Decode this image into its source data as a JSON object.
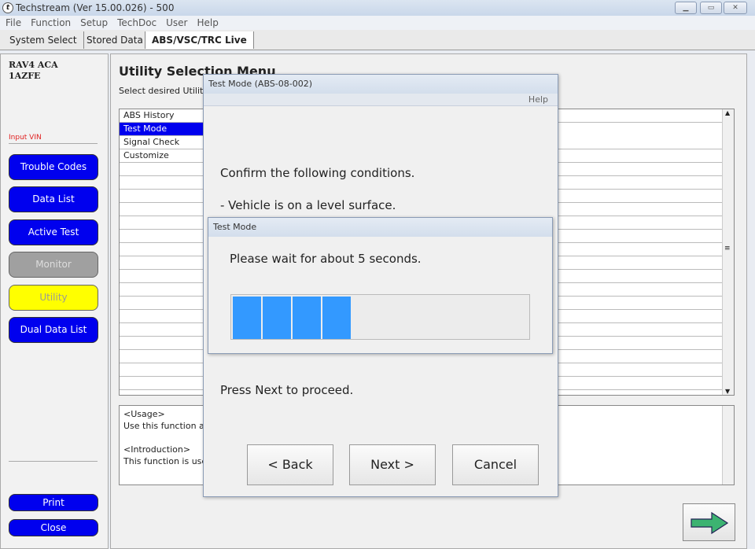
{
  "window": {
    "title": "Techstream (Ver 15.00.026) - 500",
    "controls": [
      "minimize",
      "maximize",
      "close"
    ]
  },
  "menu": [
    "File",
    "Function",
    "Setup",
    "TechDoc",
    "User",
    "Help"
  ],
  "tabs": [
    {
      "label": "System Select"
    },
    {
      "label": "Stored Data"
    },
    {
      "label": "ABS/VSC/TRC Live",
      "active": true
    }
  ],
  "vehicle": {
    "model": "RAV4 ACA",
    "engine": "1AZFE"
  },
  "sidebar": {
    "input_vin": "Input VIN",
    "buttons": [
      {
        "label": "Trouble Codes",
        "color": "#0000ee"
      },
      {
        "label": "Data List",
        "color": "#0000ee"
      },
      {
        "label": "Active Test",
        "color": "#0000ee"
      },
      {
        "label": "Monitor",
        "color": "#a0a0a0",
        "disabled": true
      },
      {
        "label": "Utility",
        "color": "#ffff00",
        "active": true
      },
      {
        "label": "Dual Data List",
        "color": "#0000ee"
      }
    ],
    "print": "Print",
    "close": "Close"
  },
  "main": {
    "title": "Utility Selection Menu",
    "subtitle": "Select desired Utility",
    "items": [
      "ABS History",
      "Test Mode",
      "Signal Check",
      "Customize"
    ],
    "selected": "Test Mode",
    "usage": [
      "<Usage>",
      "Use this function a",
      "",
      "<Introduction>",
      "This function is use"
    ]
  },
  "dialog": {
    "title": "Test Mode (ABS-08-002)",
    "help": "Help",
    "confirm": "Confirm the following conditions.",
    "cond1": "- Vehicle is on a level surface.",
    "proceed": "Press Next to proceed.",
    "back": "< Back",
    "next": "Next >",
    "cancel": "Cancel"
  },
  "progress": {
    "title": "Test Mode",
    "message": "Please wait for about 5 seconds.",
    "segments_filled": 4,
    "segments_total": 10,
    "color": "#3399ff"
  }
}
